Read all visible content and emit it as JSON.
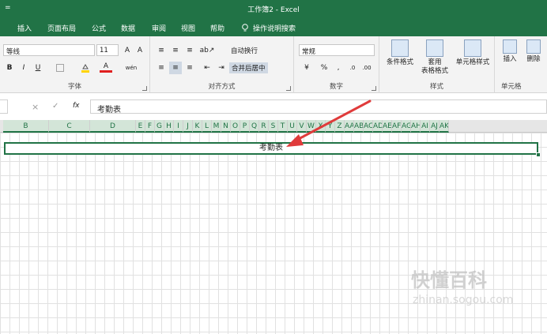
{
  "window": {
    "title": "工作簿2  -  Excel",
    "qat": "="
  },
  "tabs": [
    "插入",
    "页面布局",
    "公式",
    "数据",
    "审阅",
    "视图",
    "帮助",
    "操作说明搜索"
  ],
  "font": {
    "name": "等线",
    "size": "11",
    "grow": "A",
    "shrink": "A",
    "wen": "wén",
    "bold": "B",
    "italic": "I",
    "underline": "U",
    "fontcolor": "A",
    "label": "字体"
  },
  "alignment": {
    "wrap": "自动换行",
    "merge": "合并后居中",
    "label": "对齐方式"
  },
  "number": {
    "format": "常规",
    "percent": "%",
    "comma": ",",
    "label": "数字"
  },
  "styles": {
    "cond": "条件格式",
    "table1": "套用",
    "table2": "表格格式",
    "cell": "单元格样式",
    "label": "样式"
  },
  "cells": {
    "insert": "插入",
    "delete": "删除",
    "label": "单元格"
  },
  "formula": {
    "content": "考勤表",
    "cancel": "×",
    "confirm": "✓",
    "fx": "fx"
  },
  "columns": [
    "B",
    "C",
    "D",
    "E",
    "F",
    "G",
    "H",
    "I",
    "J",
    "K",
    "L",
    "M",
    "N",
    "O",
    "P",
    "Q",
    "R",
    "S",
    "T",
    "U",
    "V",
    "W",
    "X",
    "Y",
    "Z",
    "AA",
    "AB",
    "AC",
    "AD",
    "AE",
    "AF",
    "AG",
    "AH",
    "AI",
    "AJ",
    "AK"
  ],
  "cell_text": "考勤表",
  "watermark": "快懂百科",
  "watermark_sub": "zhinan.sogou.com",
  "colors": {
    "accent": "#217346",
    "arrow": "#e03b3b"
  }
}
